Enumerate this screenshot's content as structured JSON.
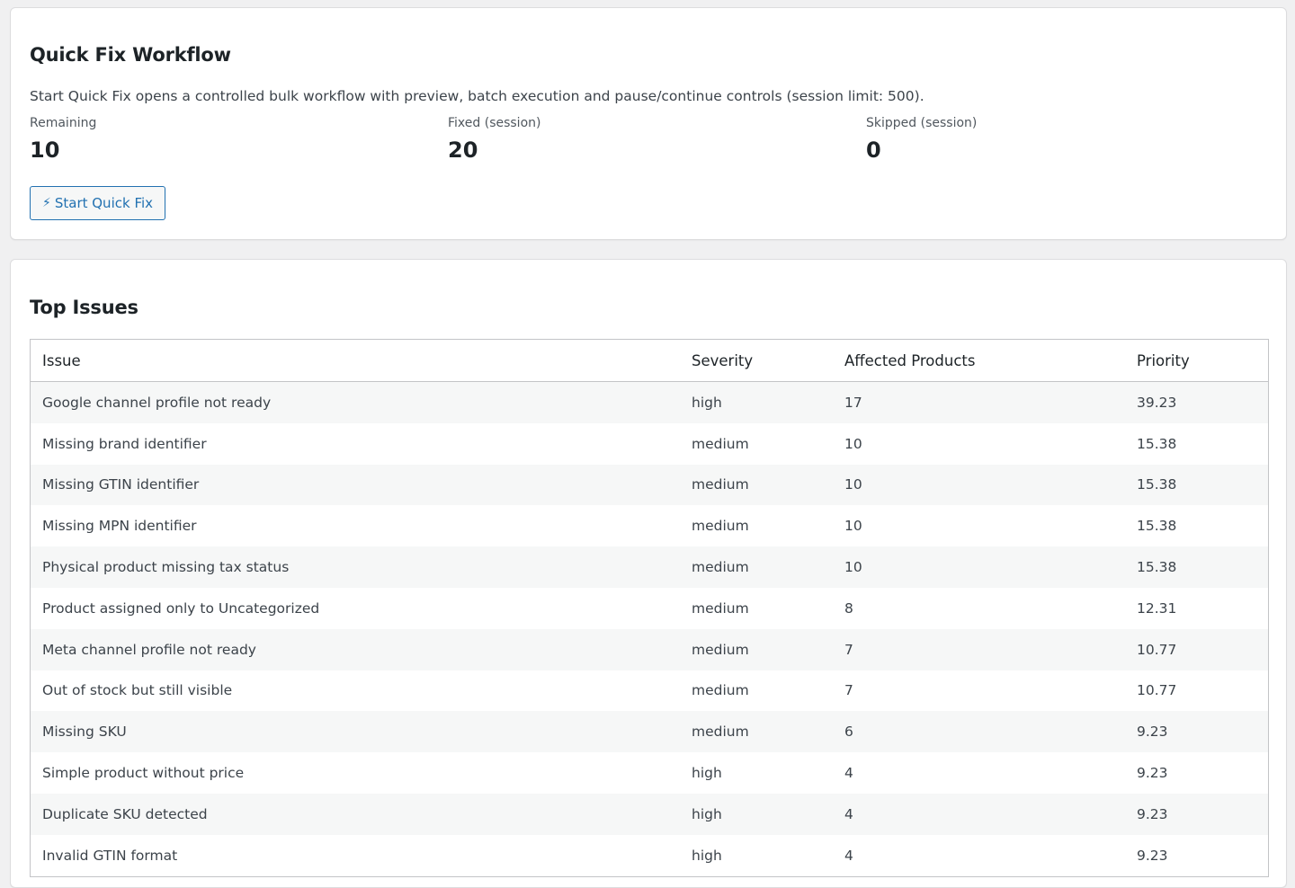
{
  "quick_fix": {
    "title": "Quick Fix Workflow",
    "description": "Start Quick Fix opens a controlled bulk workflow with preview, batch execution and pause/continue controls (session limit: 500).",
    "stats": {
      "remaining_label": "Remaining",
      "remaining_value": "10",
      "fixed_label": "Fixed (session)",
      "fixed_value": "20",
      "skipped_label": "Skipped (session)",
      "skipped_value": "0"
    },
    "button_icon": "⚡",
    "button_icon_name": "lightning-icon",
    "button_label": "Start Quick Fix"
  },
  "top_issues": {
    "title": "Top Issues",
    "columns": {
      "issue": "Issue",
      "severity": "Severity",
      "affected": "Affected Products",
      "priority": "Priority"
    },
    "rows": [
      {
        "issue": "Google channel profile not ready",
        "severity": "high",
        "affected": "17",
        "priority": "39.23"
      },
      {
        "issue": "Missing brand identifier",
        "severity": "medium",
        "affected": "10",
        "priority": "15.38"
      },
      {
        "issue": "Missing GTIN identifier",
        "severity": "medium",
        "affected": "10",
        "priority": "15.38"
      },
      {
        "issue": "Missing MPN identifier",
        "severity": "medium",
        "affected": "10",
        "priority": "15.38"
      },
      {
        "issue": "Physical product missing tax status",
        "severity": "medium",
        "affected": "10",
        "priority": "15.38"
      },
      {
        "issue": "Product assigned only to Uncategorized",
        "severity": "medium",
        "affected": "8",
        "priority": "12.31"
      },
      {
        "issue": "Meta channel profile not ready",
        "severity": "medium",
        "affected": "7",
        "priority": "10.77"
      },
      {
        "issue": "Out of stock but still visible",
        "severity": "medium",
        "affected": "7",
        "priority": "10.77"
      },
      {
        "issue": "Missing SKU",
        "severity": "medium",
        "affected": "6",
        "priority": "9.23"
      },
      {
        "issue": "Simple product without price",
        "severity": "high",
        "affected": "4",
        "priority": "9.23"
      },
      {
        "issue": "Duplicate SKU detected",
        "severity": "high",
        "affected": "4",
        "priority": "9.23"
      },
      {
        "issue": "Invalid GTIN format",
        "severity": "high",
        "affected": "4",
        "priority": "9.23"
      }
    ]
  },
  "colors": {
    "accent": "#2271b1",
    "background": "#f0f0f1",
    "card": "#ffffff",
    "row_stripe": "#f6f7f7"
  }
}
